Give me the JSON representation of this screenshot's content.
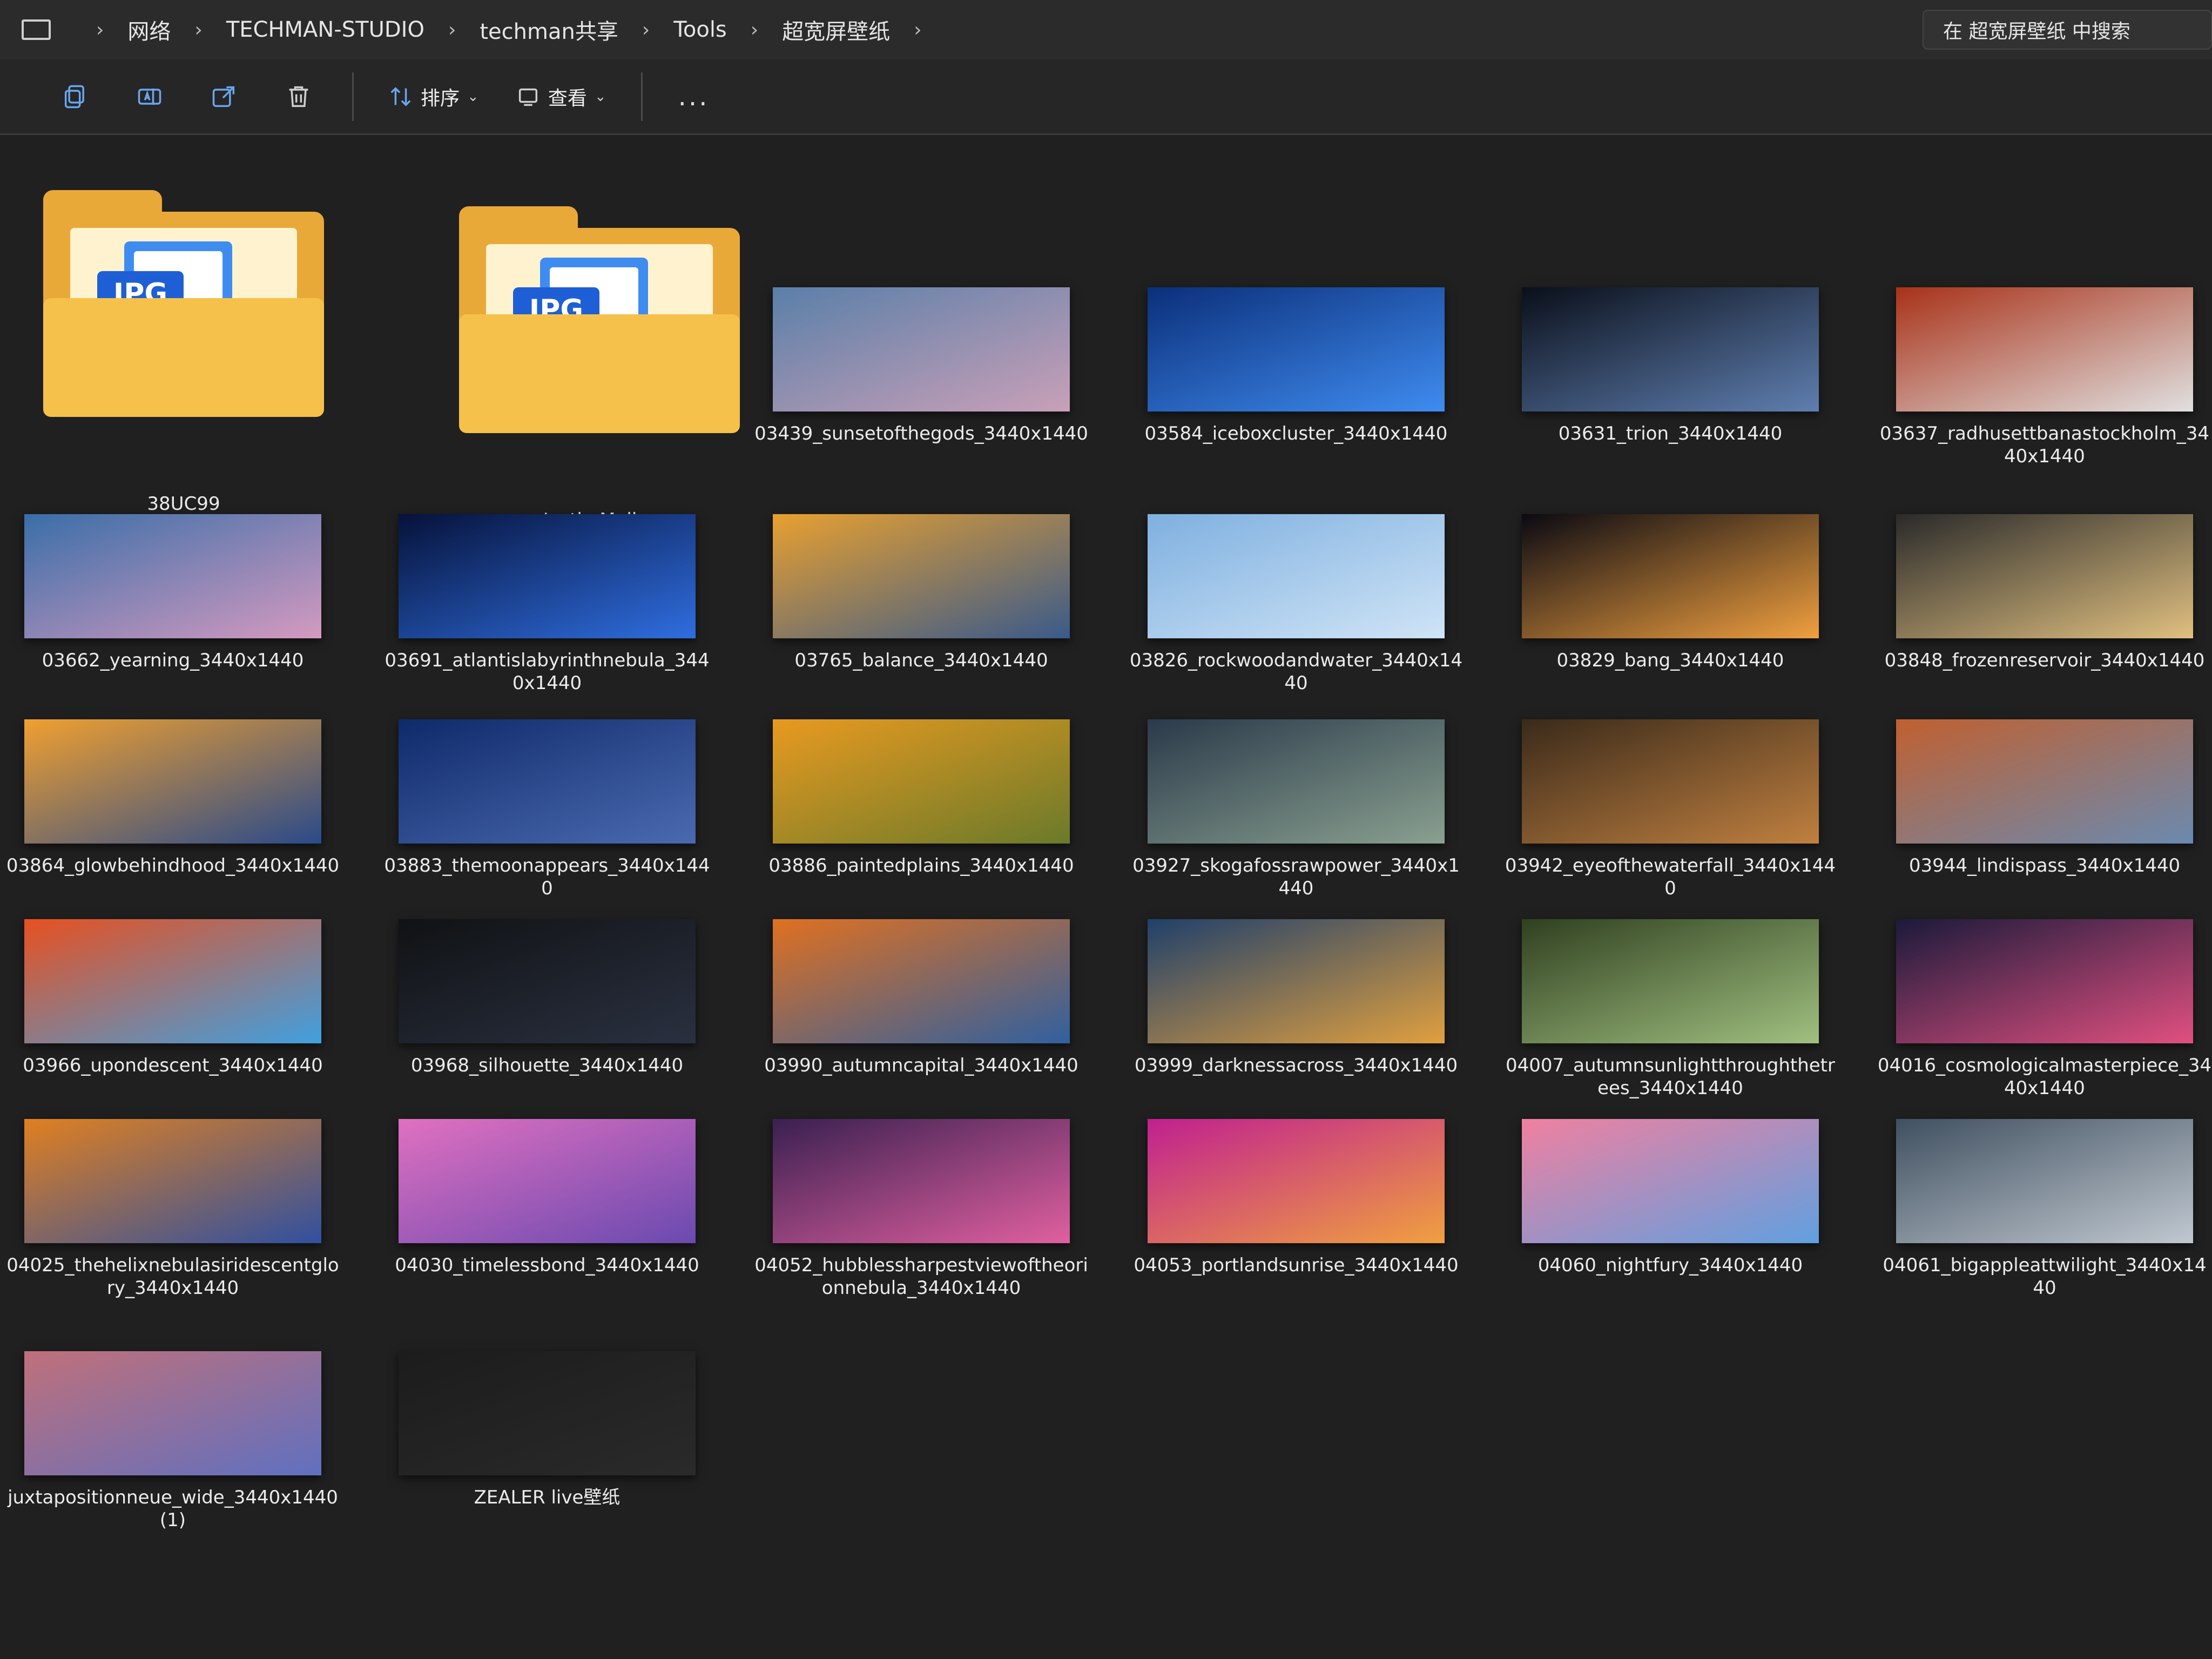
{
  "breadcrumb": [
    "网络",
    "TECHMAN-STUDIO",
    "techman共享",
    "Tools",
    "超宽屏壁纸"
  ],
  "search": {
    "placeholder": "在 超宽屏壁纸 中搜索"
  },
  "toolbar": {
    "sort_label": "排序",
    "view_label": "查看",
    "more_label": "..."
  },
  "folders": [
    {
      "name": "38UC99",
      "badge": "JPG"
    },
    {
      "name": "Justin Maller",
      "badge": "JPG"
    }
  ],
  "files": [
    "03439_sunsetofthegods_3440x1440",
    "03584_iceboxcluster_3440x1440",
    "03631_trion_3440x1440",
    "03637_radhusettbanastockholm_3440x1440",
    "03662_yearning_3440x1440",
    "03691_atlantislabyrinthnebula_3440x1440",
    "03765_balance_3440x1440",
    "03826_rockwoodandwater_3440x1440",
    "03829_bang_3440x1440",
    "03848_frozenreservoir_3440x1440",
    "03864_glowbehindhood_3440x1440",
    "03883_themoonappears_3440x1440",
    "03886_paintedplains_3440x1440",
    "03927_skogafossrawpower_3440x1440",
    "03942_eyeofthewaterfall_3440x1440",
    "03944_lindispass_3440x1440",
    "03966_upondescent_3440x1440",
    "03968_silhouette_3440x1440",
    "03990_autumncapital_3440x1440",
    "03999_darknessacross_3440x1440",
    "04007_autumnsunlightthroughthetrees_3440x1440",
    "04016_cosmologicalmasterpiece_3440x1440",
    "04025_thehelixnebulasiridescentglory_3440x1440",
    "04030_timelessbond_3440x1440",
    "04052_hubblessharpestviewoftheorionnebula_3440x1440",
    "04053_portlandsunrise_3440x1440",
    "04060_nightfury_3440x1440",
    "04061_bigappleattwilight_3440x1440",
    "juxtapositionneue_wide_3440x1440 (1)",
    "ZEALER live壁纸"
  ],
  "thumb_colors": [
    [
      "#5a7fa8",
      "#c9a0b8"
    ],
    [
      "#0b2f7a",
      "#3f8cf0"
    ],
    [
      "#0a0f1a",
      "#5f7fb0"
    ],
    [
      "#a83218",
      "#e0e0e0"
    ],
    [
      "#3a6ea8",
      "#d49ac0"
    ],
    [
      "#06123a",
      "#2f6ee0"
    ],
    [
      "#e8a030",
      "#3a5a8a"
    ],
    [
      "#7fb0e0",
      "#cfe4f6"
    ],
    [
      "#0a0a12",
      "#f0a040"
    ],
    [
      "#2a2a2a",
      "#e0c080"
    ],
    [
      "#f0a030",
      "#2a4a8a"
    ],
    [
      "#0f2a6a",
      "#4a6ab0"
    ],
    [
      "#e89a20",
      "#6a7a2a"
    ],
    [
      "#2a3a4a",
      "#8aa090"
    ],
    [
      "#3a2a1a",
      "#c08040"
    ],
    [
      "#c06030",
      "#6a8ab0"
    ],
    [
      "#e85020",
      "#40a0e0"
    ],
    [
      "#101214",
      "#2a3040"
    ],
    [
      "#e07020",
      "#3060a0"
    ],
    [
      "#20406a",
      "#e0a040"
    ],
    [
      "#304020",
      "#a0c080"
    ],
    [
      "#1a1a3a",
      "#e05080"
    ],
    [
      "#e08020",
      "#3050a0"
    ],
    [
      "#e070c0",
      "#6a4ab0"
    ],
    [
      "#3a2050",
      "#e060a0"
    ],
    [
      "#c02090",
      "#f0a040"
    ],
    [
      "#f080a0",
      "#60a0e0"
    ],
    [
      "#405060",
      "#c0c8d0"
    ],
    [
      "#c0707a",
      "#6070c0"
    ],
    [
      "#1c1c1c",
      "#2a2a2a"
    ]
  ]
}
